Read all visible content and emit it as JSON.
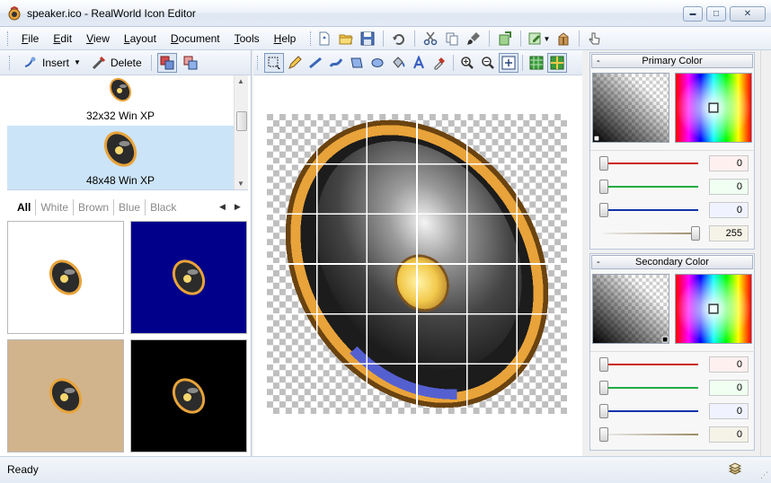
{
  "window": {
    "title": "speaker.ico - RealWorld Icon Editor",
    "minimize_glyph": "▬",
    "maximize_glyph": "□",
    "close_glyph": "✕"
  },
  "menu": [
    {
      "label": "File",
      "key": "F",
      "rest": "ile"
    },
    {
      "label": "Edit",
      "key": "E",
      "rest": "dit"
    },
    {
      "label": "View",
      "key": "V",
      "rest": "iew"
    },
    {
      "label": "Layout",
      "key": "L",
      "rest": "ayout"
    },
    {
      "label": "Document",
      "key": "D",
      "rest": "ocument"
    },
    {
      "label": "Tools",
      "key": "T",
      "rest": "ools"
    },
    {
      "label": "Help",
      "key": "H",
      "rest": "elp"
    }
  ],
  "formats_panel": {
    "insert_label": "Insert",
    "delete_label": "Delete",
    "items": [
      {
        "label": "32x32 Win XP",
        "selected": false
      },
      {
        "label": "48x48 Win XP",
        "selected": true
      }
    ]
  },
  "preview": {
    "tabs": [
      "All",
      "White",
      "Brown",
      "Blue",
      "Black"
    ],
    "active_tab": "All",
    "backgrounds": [
      "#ffffff",
      "#00008b",
      "#d2b48c",
      "#000000"
    ]
  },
  "primary": {
    "title": "Primary Color",
    "collapse_glyph": "-",
    "values": [
      "0",
      "0",
      "0",
      "255"
    ]
  },
  "secondary": {
    "title": "Secondary Color",
    "collapse_glyph": "-",
    "values": [
      "0",
      "0",
      "0",
      "0"
    ]
  },
  "status": {
    "text": "Ready"
  },
  "colors": {
    "accent_selected": "#cce4f7",
    "ring_gold": "#e8a33a",
    "red_channel": "#cc2222",
    "green_channel": "#22aa44",
    "blue_channel": "#1133aa"
  }
}
